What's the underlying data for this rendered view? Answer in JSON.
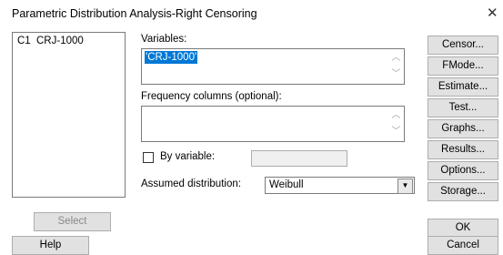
{
  "window": {
    "title": "Parametric Distribution Analysis-Right Censoring",
    "close_glyph": "✕"
  },
  "columns_list": [
    {
      "id": "C1",
      "name": "CRJ-1000"
    }
  ],
  "variables": {
    "label": "Variables:",
    "value": "'CRJ-1000'"
  },
  "frequency": {
    "label": "Frequency columns (optional):",
    "value": ""
  },
  "by_variable": {
    "label": "By variable:",
    "checked": false,
    "value": ""
  },
  "distribution": {
    "label": "Assumed distribution:",
    "value": "Weibull"
  },
  "side_buttons": [
    "Censor...",
    "FMode...",
    "Estimate...",
    "Test...",
    "Graphs...",
    "Results...",
    "Options...",
    "Storage..."
  ],
  "buttons": {
    "select": "Select",
    "help": "Help",
    "ok": "OK",
    "cancel": "Cancel"
  },
  "icons": {
    "scroll_up": "scroll-up-icon",
    "scroll_down": "scroll-down-icon",
    "dropdown": "chevron-down-icon",
    "close": "close-icon"
  },
  "colors": {
    "selection": "#0078d7",
    "button_face": "#e1e1e1",
    "border": "#7a7a7a"
  }
}
